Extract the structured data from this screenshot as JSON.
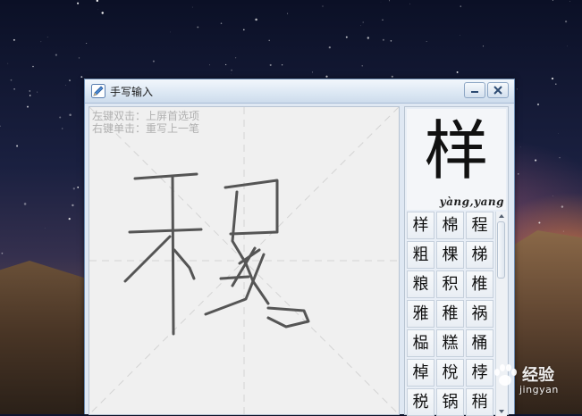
{
  "window": {
    "title": "手写输入",
    "minimize_label": "minimize",
    "close_label": "close"
  },
  "canvas": {
    "hint_line1": "左键双击：上屏首选项",
    "hint_line2": "右键单击：重写上一笔"
  },
  "preview": {
    "character": "样",
    "pinyin": "yàng,yang"
  },
  "candidates": [
    [
      "样",
      "棉",
      "程"
    ],
    [
      "粗",
      "棵",
      "梯"
    ],
    [
      "粮",
      "积",
      "椎"
    ],
    [
      "雅",
      "稚",
      "祸"
    ],
    [
      "榀",
      "糕",
      "桶"
    ],
    [
      "棹",
      "梲",
      "桲"
    ],
    [
      "税",
      "锅",
      "稍"
    ]
  ],
  "watermark": {
    "text": "经验",
    "sub": "jingyan"
  },
  "icons": {
    "title": "pen-icon",
    "minimize": "minimize-icon",
    "close": "close-icon",
    "scroll_up": "arrow-up-icon",
    "scroll_down": "arrow-down-icon",
    "watermark": "paw-icon"
  }
}
